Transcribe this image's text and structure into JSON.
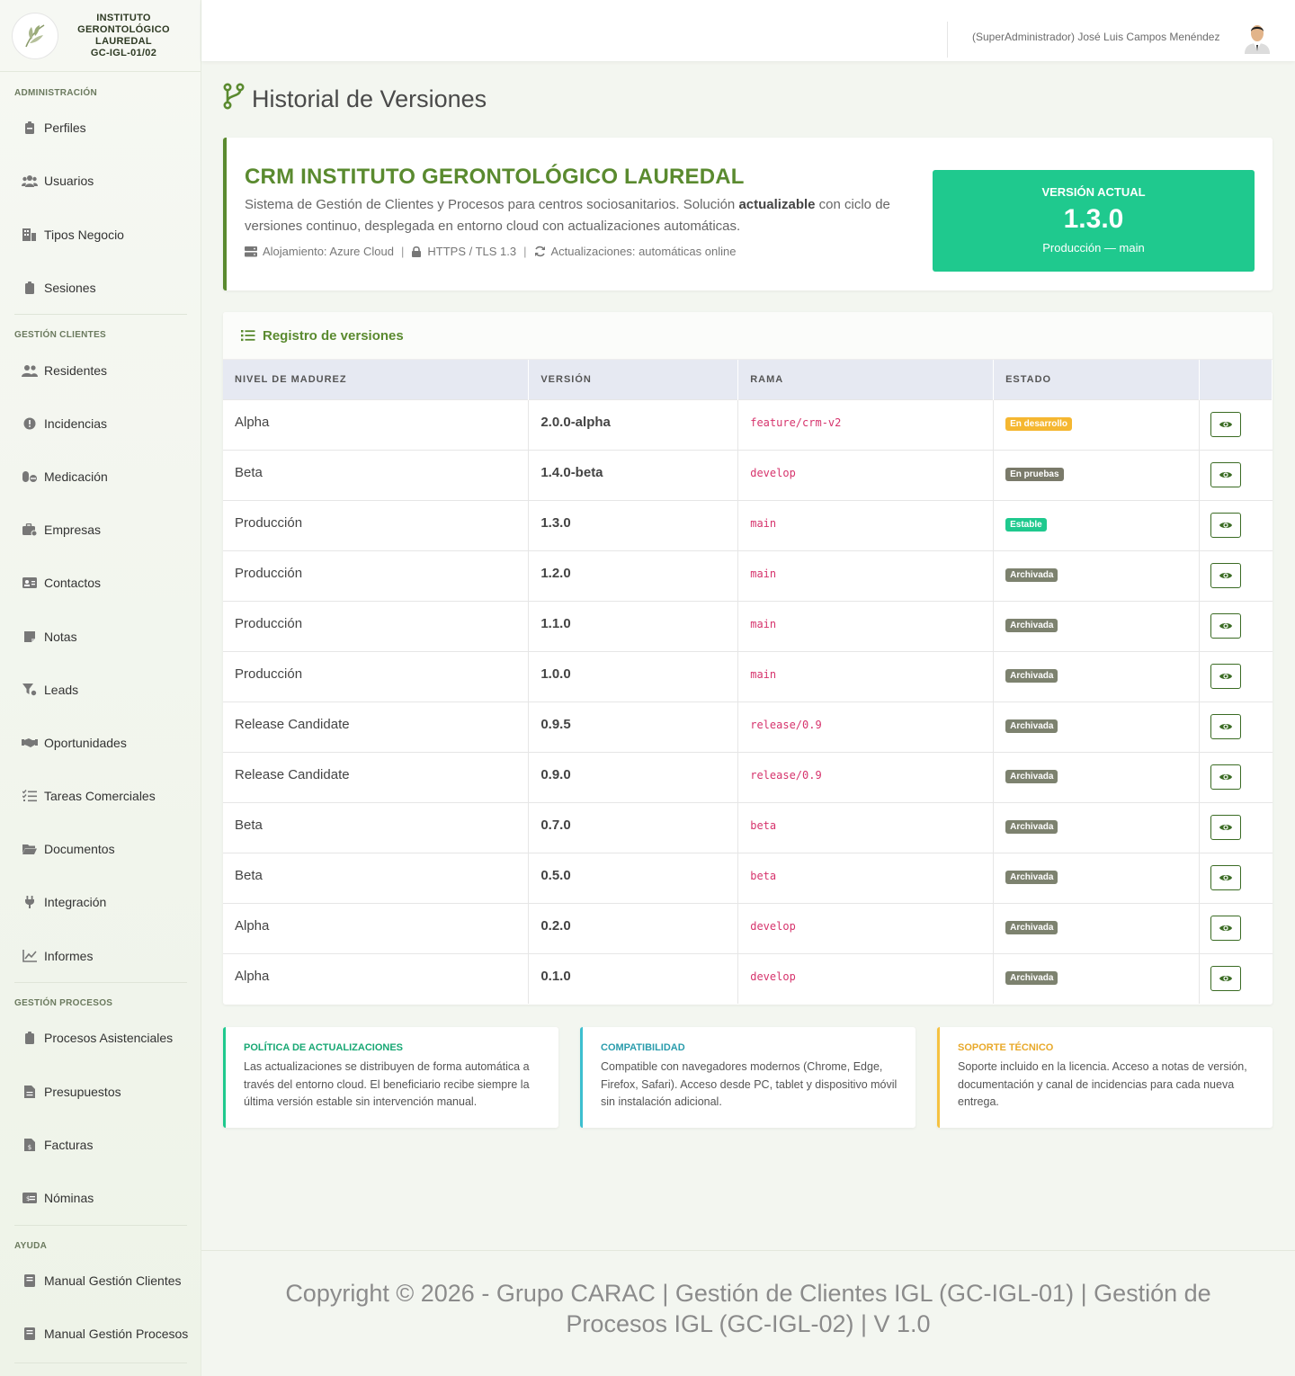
{
  "brand": {
    "line1": "INSTITUTO",
    "line2": "GERONTOLÓGICO",
    "line3": "LAUREDAL",
    "line4": "GC-IGL-01/02"
  },
  "sidebar": {
    "sections": [
      {
        "label": "ADMINISTRACIÓN"
      },
      {
        "label": "GESTIÓN CLIENTES"
      },
      {
        "label": "GESTIÓN PROCESOS"
      },
      {
        "label": "AYUDA"
      }
    ],
    "items": [
      {
        "label": "Perfiles",
        "icon": "badge-icon"
      },
      {
        "label": "Usuarios",
        "icon": "users-icon"
      },
      {
        "label": "Tipos Negocio",
        "icon": "building-icon"
      },
      {
        "label": "Sesiones",
        "icon": "clipboard-icon"
      },
      {
        "label": "Residentes",
        "icon": "users-icon"
      },
      {
        "label": "Incidencias",
        "icon": "alert-icon"
      },
      {
        "label": "Medicación",
        "icon": "pills-icon"
      },
      {
        "label": "Empresas",
        "icon": "briefcase-icon"
      },
      {
        "label": "Contactos",
        "icon": "id-card-icon"
      },
      {
        "label": "Notas",
        "icon": "note-icon"
      },
      {
        "label": "Leads",
        "icon": "funnel-icon"
      },
      {
        "label": "Oportunidades",
        "icon": "handshake-icon"
      },
      {
        "label": "Tareas Comerciales",
        "icon": "tasks-icon"
      },
      {
        "label": "Documentos",
        "icon": "folder-icon"
      },
      {
        "label": "Integración",
        "icon": "plug-icon"
      },
      {
        "label": "Informes",
        "icon": "chart-icon"
      },
      {
        "label": "Procesos Asistenciales",
        "icon": "clipboard-icon"
      },
      {
        "label": "Presupuestos",
        "icon": "file-icon"
      },
      {
        "label": "Facturas",
        "icon": "invoice-icon"
      },
      {
        "label": "Nóminas",
        "icon": "money-icon"
      },
      {
        "label": "Manual Gestión Clientes",
        "icon": "book-icon"
      },
      {
        "label": "Manual Gestión Procesos",
        "icon": "book-icon"
      }
    ]
  },
  "topbar": {
    "user": "(SuperAdministrador) José Luis Campos Menéndez"
  },
  "page": {
    "title": "Historial de Versiones"
  },
  "hero": {
    "title": "CRM INSTITUTO GERONTOLÓGICO LAUREDAL",
    "desc_before": "Sistema de Gestión de Clientes y Procesos para centros sociosanitarios. Solución ",
    "desc_bold": "actualizable",
    "desc_after": " con ciclo de versiones continuo, desplegada en entorno cloud con actualizaciones automáticas.",
    "meta_hosting": "Alojamiento: Azure Cloud",
    "meta_security": "HTTPS / TLS 1.3",
    "meta_updates": "Actualizaciones: automáticas online",
    "separator": "|",
    "current_label": "VERSIÓN ACTUAL",
    "current_version": "1.3.0",
    "current_sub": "Producción — main"
  },
  "registry": {
    "title": "Registro de versiones",
    "headers": [
      "NIVEL DE MADUREZ",
      "VERSIÓN",
      "RAMA",
      "ESTADO"
    ],
    "rows": [
      {
        "level": "Alpha",
        "version": "2.0.0-alpha",
        "branch": "feature/crm-v2",
        "status": "En desarrollo",
        "color": "#f5b731"
      },
      {
        "level": "Beta",
        "version": "1.4.0-beta",
        "branch": "develop",
        "status": "En pruebas",
        "color": "#7a7a6a"
      },
      {
        "level": "Producción",
        "version": "1.3.0",
        "branch": "main",
        "status": "Estable",
        "color": "#1fc98e"
      },
      {
        "level": "Producción",
        "version": "1.2.0",
        "branch": "main",
        "status": "Archivada",
        "color": "#7d826f"
      },
      {
        "level": "Producción",
        "version": "1.1.0",
        "branch": "main",
        "status": "Archivada",
        "color": "#7d826f"
      },
      {
        "level": "Producción",
        "version": "1.0.0",
        "branch": "main",
        "status": "Archivada",
        "color": "#7d826f"
      },
      {
        "level": "Release Candidate",
        "version": "0.9.5",
        "branch": "release/0.9",
        "status": "Archivada",
        "color": "#7d826f"
      },
      {
        "level": "Release Candidate",
        "version": "0.9.0",
        "branch": "release/0.9",
        "status": "Archivada",
        "color": "#7d826f"
      },
      {
        "level": "Beta",
        "version": "0.7.0",
        "branch": "beta",
        "status": "Archivada",
        "color": "#7d826f"
      },
      {
        "level": "Beta",
        "version": "0.5.0",
        "branch": "beta",
        "status": "Archivada",
        "color": "#7d826f"
      },
      {
        "level": "Alpha",
        "version": "0.2.0",
        "branch": "develop",
        "status": "Archivada",
        "color": "#7d826f"
      },
      {
        "level": "Alpha",
        "version": "0.1.0",
        "branch": "develop",
        "status": "Archivada",
        "color": "#7d826f"
      }
    ]
  },
  "info": [
    {
      "title": "POLÍTICA DE ACTUALIZACIONES",
      "body": "Las actualizaciones se distribuyen de forma automática a través del entorno cloud. El beneficiario recibe siempre la última versión estable sin intervención manual.",
      "color": "#1fc98e",
      "title_color": "#18a874"
    },
    {
      "title": "COMPATIBILIDAD",
      "body": "Compatible con navegadores modernos (Chrome, Edge, Firefox, Safari). Acceso desde PC, tablet y dispositivo móvil sin instalación adicional.",
      "color": "#3cbfcf",
      "title_color": "#2a9cac"
    },
    {
      "title": "SOPORTE TÉCNICO",
      "body": "Soporte incluido en la licencia. Acceso a notas de versión, documentación y canal de incidencias para cada nueva entrega.",
      "color": "#f5c242",
      "title_color": "#e8a92a"
    }
  ],
  "footer": {
    "text": "Copyright © 2026 - Grupo CARAC | Gestión de Clientes IGL (GC-IGL-01) | Gestión de Procesos IGL (GC-IGL-02) | V 1.0"
  }
}
